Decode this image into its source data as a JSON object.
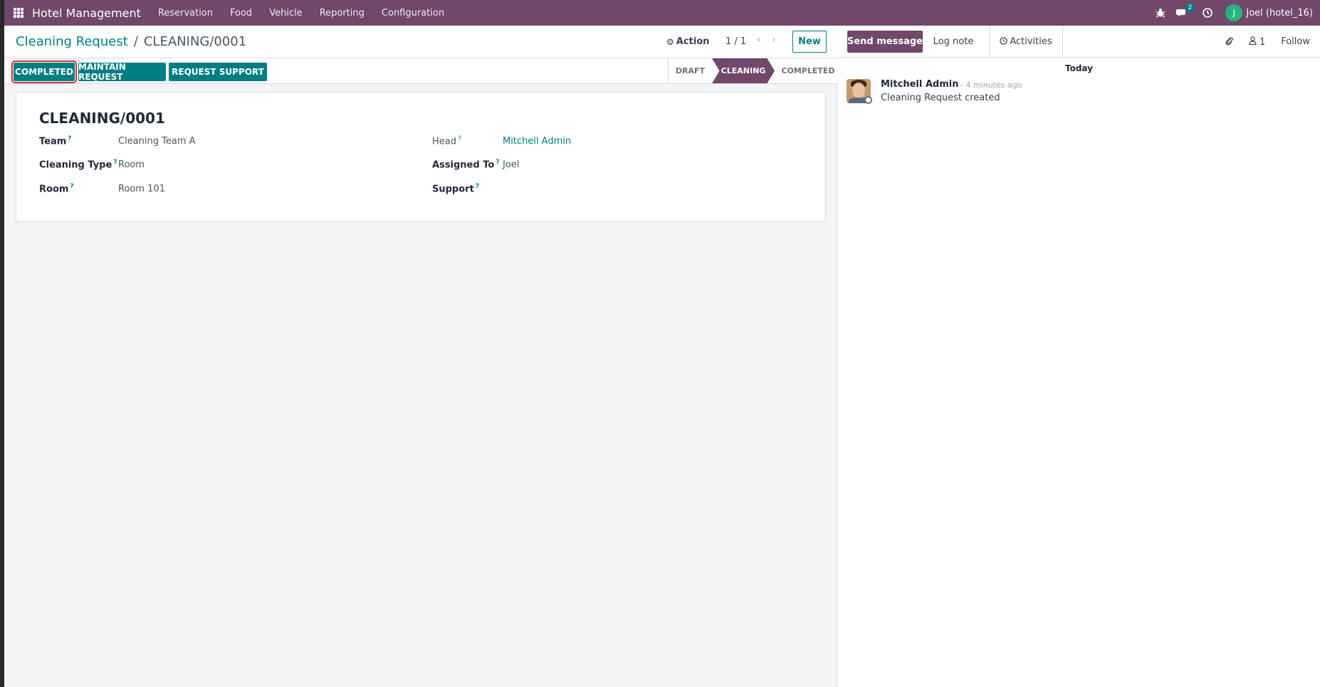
{
  "navbar": {
    "app_title": "Hotel Management",
    "menu": [
      "Reservation",
      "Food",
      "Vehicle",
      "Reporting",
      "Configuration"
    ],
    "messages_count": "2",
    "user_initial": "J",
    "user_name": "Joel (hotel_16)"
  },
  "control_panel": {
    "breadcrumb_parent": "Cleaning Request",
    "breadcrumb_separator": "/",
    "breadcrumb_current": "CLEANING/0001",
    "action_label": "Action",
    "pager": "1 / 1",
    "new_label": "New"
  },
  "statusbar": {
    "buttons": [
      "COMPLETED",
      "MAINTAIN REQUEST",
      "REQUEST SUPPORT"
    ],
    "stages": [
      "DRAFT",
      "CLEANING",
      "COMPLETED"
    ],
    "active_stage": "CLEANING"
  },
  "record": {
    "name": "CLEANING/0001",
    "fields_left": [
      {
        "label": "Team",
        "value": "Cleaning Team A"
      },
      {
        "label": "Cleaning Type",
        "value": "Room"
      },
      {
        "label": "Room",
        "value": "Room 101"
      }
    ],
    "fields_right": [
      {
        "label": "Head",
        "value": "Mitchell Admin"
      },
      {
        "label": "Assigned To",
        "value": "Joel"
      },
      {
        "label": "Support",
        "value": ""
      }
    ],
    "help_marker": "?"
  },
  "chatter": {
    "send_message": "Send message",
    "log_note": "Log note",
    "activities": "Activities",
    "followers_count": "1",
    "follow": "Follow",
    "date_separator": "Today",
    "message": {
      "author": "Mitchell Admin",
      "date": "- 4 minutes ago",
      "body": "Cleaning Request created"
    }
  },
  "colors": {
    "brand": "#71476a",
    "accent": "#017e84",
    "highlight_border": "#d9322b"
  }
}
